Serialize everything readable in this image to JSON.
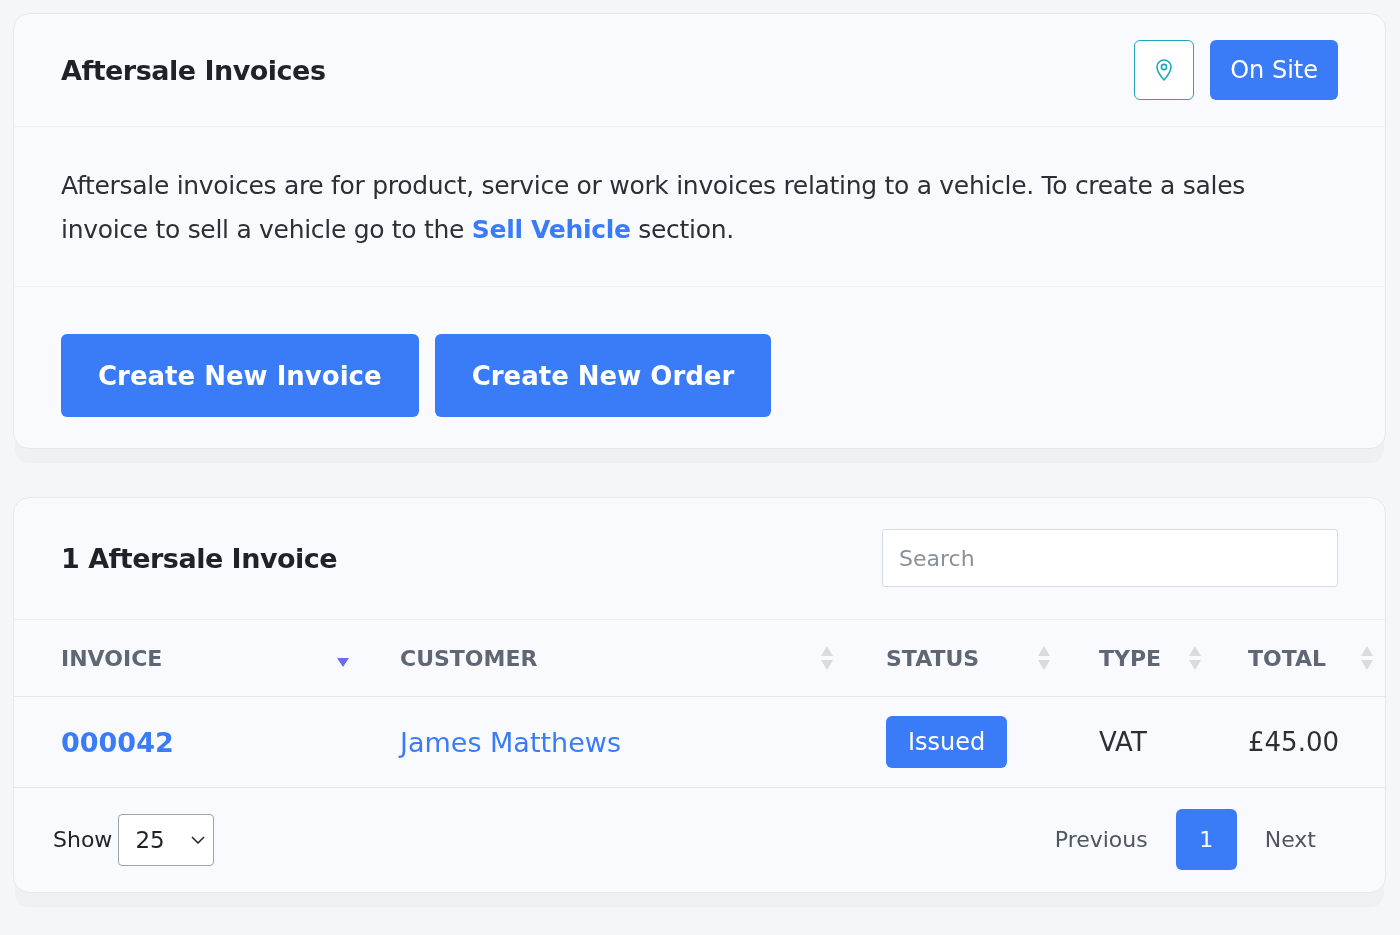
{
  "header": {
    "title": "Aftersale Invoices",
    "on_site_button": "On Site"
  },
  "intro": {
    "text": "Aftersale invoices are for product, service or work invoices relating to a vehicle. To create a sales invoice to sell a vehicle go to the ",
    "link": "Sell Vehicle",
    "after": " section."
  },
  "actions": [
    "Create New Invoice",
    "Create New Order"
  ],
  "list": {
    "title": "1 Aftersale Invoice",
    "search": {
      "placeholder": "Search"
    },
    "columns": [
      {
        "label": "INVOICE",
        "sorted": true
      },
      {
        "label": "CUSTOMER",
        "sorted": false
      },
      {
        "label": "STATUS",
        "sorted": false
      },
      {
        "label": "TYPE",
        "sorted": false
      },
      {
        "label": "TOTAL",
        "sorted": false
      }
    ],
    "rows": [
      {
        "invoice": "000042",
        "customer": "James Matthews",
        "status": "Issued",
        "type": "VAT",
        "total": "£45.00"
      }
    ],
    "show_label": "Show",
    "page_size": "25",
    "pagination": [
      {
        "label": "Previous",
        "kind": "nav"
      },
      {
        "label": "1",
        "kind": "page",
        "selected": true
      },
      {
        "label": "Next",
        "kind": "nav"
      }
    ]
  }
}
